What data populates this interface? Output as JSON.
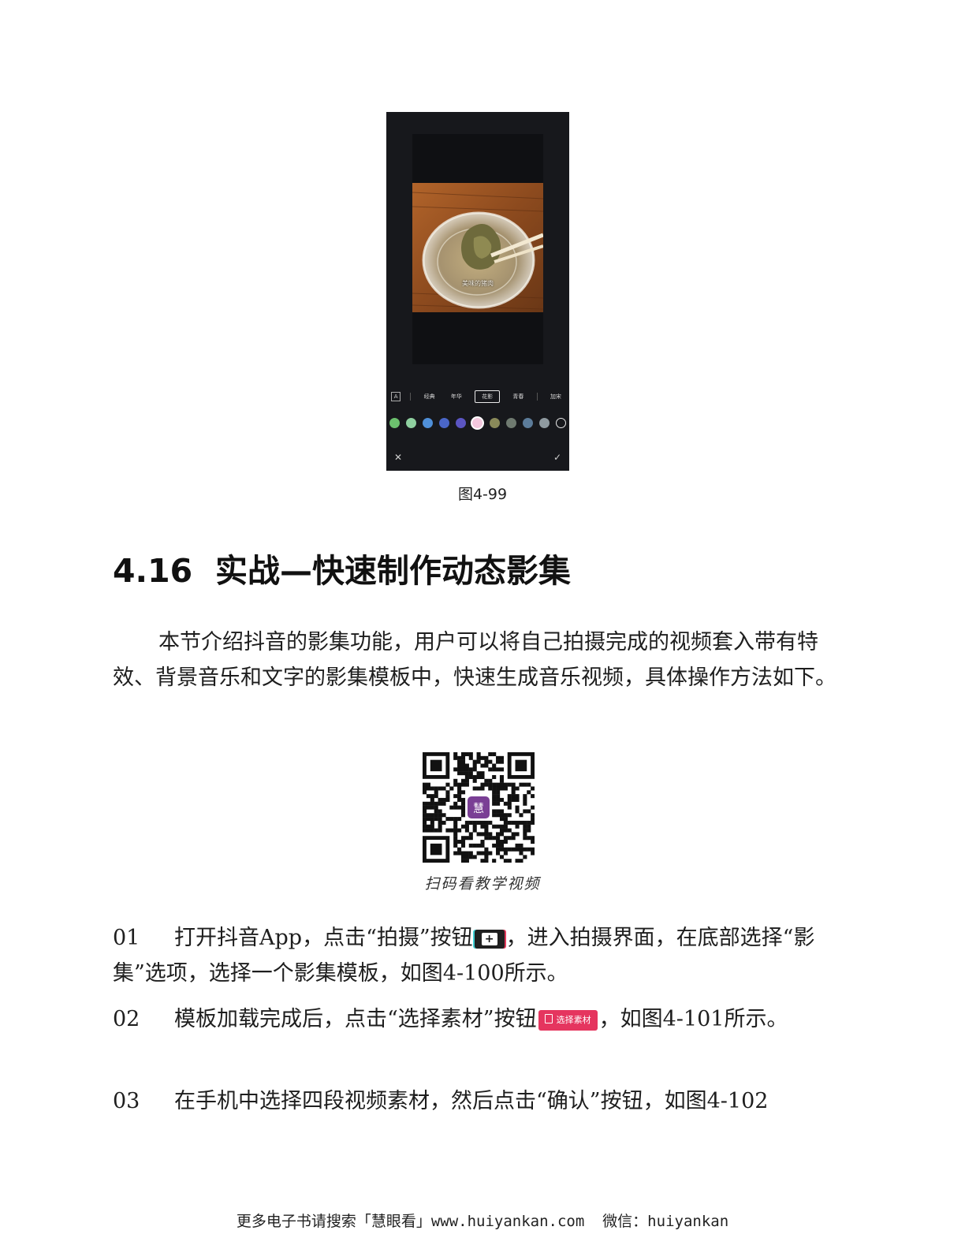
{
  "figure": {
    "caption": "图4-99",
    "phone": {
      "photo_caption": "美味的猪肉",
      "style_tabs": [
        "经典",
        "年华",
        "花影",
        "青春",
        "加宋"
      ],
      "selected_tab": "花影",
      "swatches": [
        "#6cc16e",
        "#8fd0a0",
        "#4f8fd8",
        "#4a66c8",
        "#5b55c2",
        "#f3c8de",
        "#8a8a5a",
        "#6f7a70",
        "#5c7c9a",
        "#8f9aa0",
        "#e8e8e8"
      ],
      "close_icon": "close-icon",
      "confirm_icon": "check-icon"
    }
  },
  "section": {
    "number": "4.16",
    "title": "实战—快速制作动态影集"
  },
  "intro": "本节介绍抖音的影集功能，用户可以将自己拍摄完成的视频套入带有特效、背景音乐和文字的影集模板中，快速生成音乐视频，具体操作方法如下。",
  "qr": {
    "caption": "扫码看教学视频",
    "center_label": "慧"
  },
  "steps": [
    {
      "num": "01",
      "text_before": "打开抖音App，点击“拍摄”按钮",
      "button_label": "+",
      "text_after": "，进入拍摄界面，在底部选择“影集”选项，选择一个影集模板，如图4-100所示。"
    },
    {
      "num": "02",
      "text_before": "模板加载完成后，点击“选择素材”按钮",
      "button_label": "选择素材",
      "text_after": "，如图4-101所示。"
    },
    {
      "num": "03",
      "text_before": "在手机中选择四段视频素材，然后点击“确认”按钮，如图4-102",
      "button_label": "",
      "text_after": ""
    }
  ],
  "footer": "更多电子书请搜索「慧眼看」www.huiyankan.com  微信：huiyankan"
}
